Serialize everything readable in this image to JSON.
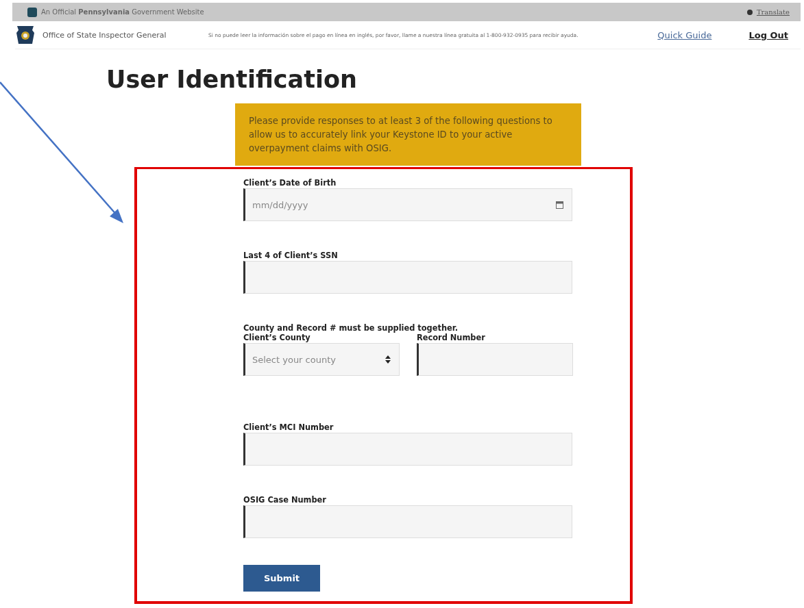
{
  "gov_banner": {
    "text": "An Official **Pennsylvania** Government Website",
    "translate": "Translate"
  },
  "header": {
    "org": "Office of State Inspector General",
    "notice": "Si no puede leer la información sobre el pago en línea en inglés, por favor, llame a nuestra línea gratuita al 1-800-932-0935 para recibir ayuda.",
    "links": [
      {
        "label": "Quick Guide",
        "kind": "link"
      },
      {
        "label": "Log Out",
        "kind": "strong"
      }
    ]
  },
  "title": "User Identification",
  "info": "Please provide responses to at least 3 of the following questions to allow us to accurately link your Keystone ID to your active overpayment claims with OSIG.",
  "rows": [
    {
      "fields": [
        {
          "label": "Client’s Date of Birth",
          "kind": "date",
          "placeholder": "mm/dd/yyyy"
        }
      ]
    },
    {
      "fields": [
        {
          "label": "Last 4 of Client’s SSN",
          "kind": "text"
        }
      ]
    },
    {
      "note": "County and Record # must be supplied together.",
      "fields": [
        {
          "label": "Client’s County",
          "kind": "select",
          "placeholder": "Select your county"
        },
        {
          "label": "Record Number",
          "kind": "text"
        }
      ]
    },
    {
      "fields": [
        {
          "label": "Client’s MCI Number",
          "kind": "text"
        }
      ]
    },
    {
      "fields": [
        {
          "label": "OSIG Case Number",
          "kind": "text"
        }
      ]
    }
  ],
  "submit": "Submit"
}
